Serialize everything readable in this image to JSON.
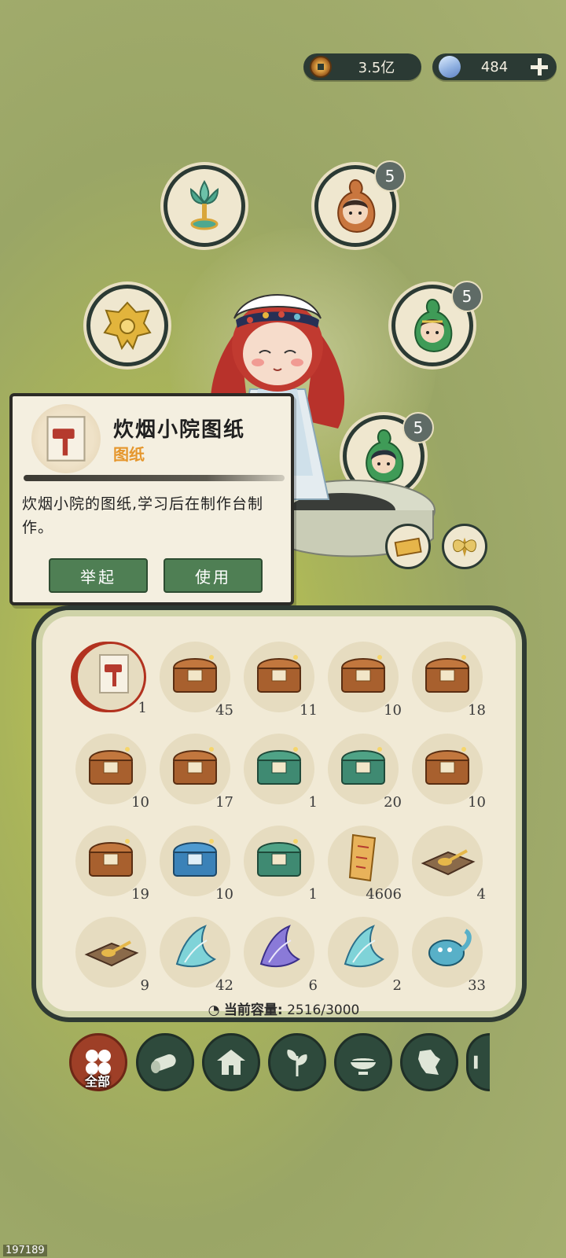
{
  "currency": {
    "coins": "3.5亿",
    "gems": "484"
  },
  "equipment_slots": {
    "slot_top_right_badge": "5",
    "slot_right_badge": "5",
    "slot_lower_right_badge": "5"
  },
  "tooltip": {
    "title": "炊烟小院图纸",
    "type": "图纸",
    "description": "炊烟小院的图纸,学习后在制作台制作。",
    "hold_button": "举起",
    "use_button": "使用"
  },
  "inventory": {
    "items": [
      {
        "icon": "blueprint-scroll",
        "count": "1"
      },
      {
        "icon": "treasure-chest",
        "count": "45"
      },
      {
        "icon": "treasure-chest",
        "count": "11"
      },
      {
        "icon": "treasure-chest",
        "count": "10"
      },
      {
        "icon": "treasure-chest",
        "count": "18"
      },
      {
        "icon": "treasure-chest",
        "count": "10"
      },
      {
        "icon": "treasure-chest",
        "count": "17"
      },
      {
        "icon": "green-chest",
        "count": "1"
      },
      {
        "icon": "green-chest",
        "count": "20"
      },
      {
        "icon": "treasure-chest",
        "count": "10"
      },
      {
        "icon": "treasure-chest",
        "count": "19"
      },
      {
        "icon": "blue-chest",
        "count": "10"
      },
      {
        "icon": "green-chest",
        "count": "1"
      },
      {
        "icon": "scroll-map",
        "count": "4606"
      },
      {
        "icon": "spoon-board",
        "count": "4"
      },
      {
        "icon": "spoon-board",
        "count": "9"
      },
      {
        "icon": "spirit-fish",
        "count": "42"
      },
      {
        "icon": "spirit-fish-purple",
        "count": "6"
      },
      {
        "icon": "spirit-fish",
        "count": "2"
      },
      {
        "icon": "spirit-beast",
        "count": "33"
      }
    ],
    "capacity_label": "当前容量:",
    "capacity_value": "2516/3000"
  },
  "categories": {
    "all_label": "全部",
    "items": [
      "all-icon",
      "log-icon",
      "house-icon",
      "sprout-icon",
      "bowl-icon",
      "map-icon",
      "scroll-icon"
    ]
  },
  "uid": "197189",
  "colors": {
    "panel_bg": "#f1ead6",
    "button_green": "#4f7f54",
    "type_orange": "#e5962c",
    "active_category": "#9e3f27"
  }
}
